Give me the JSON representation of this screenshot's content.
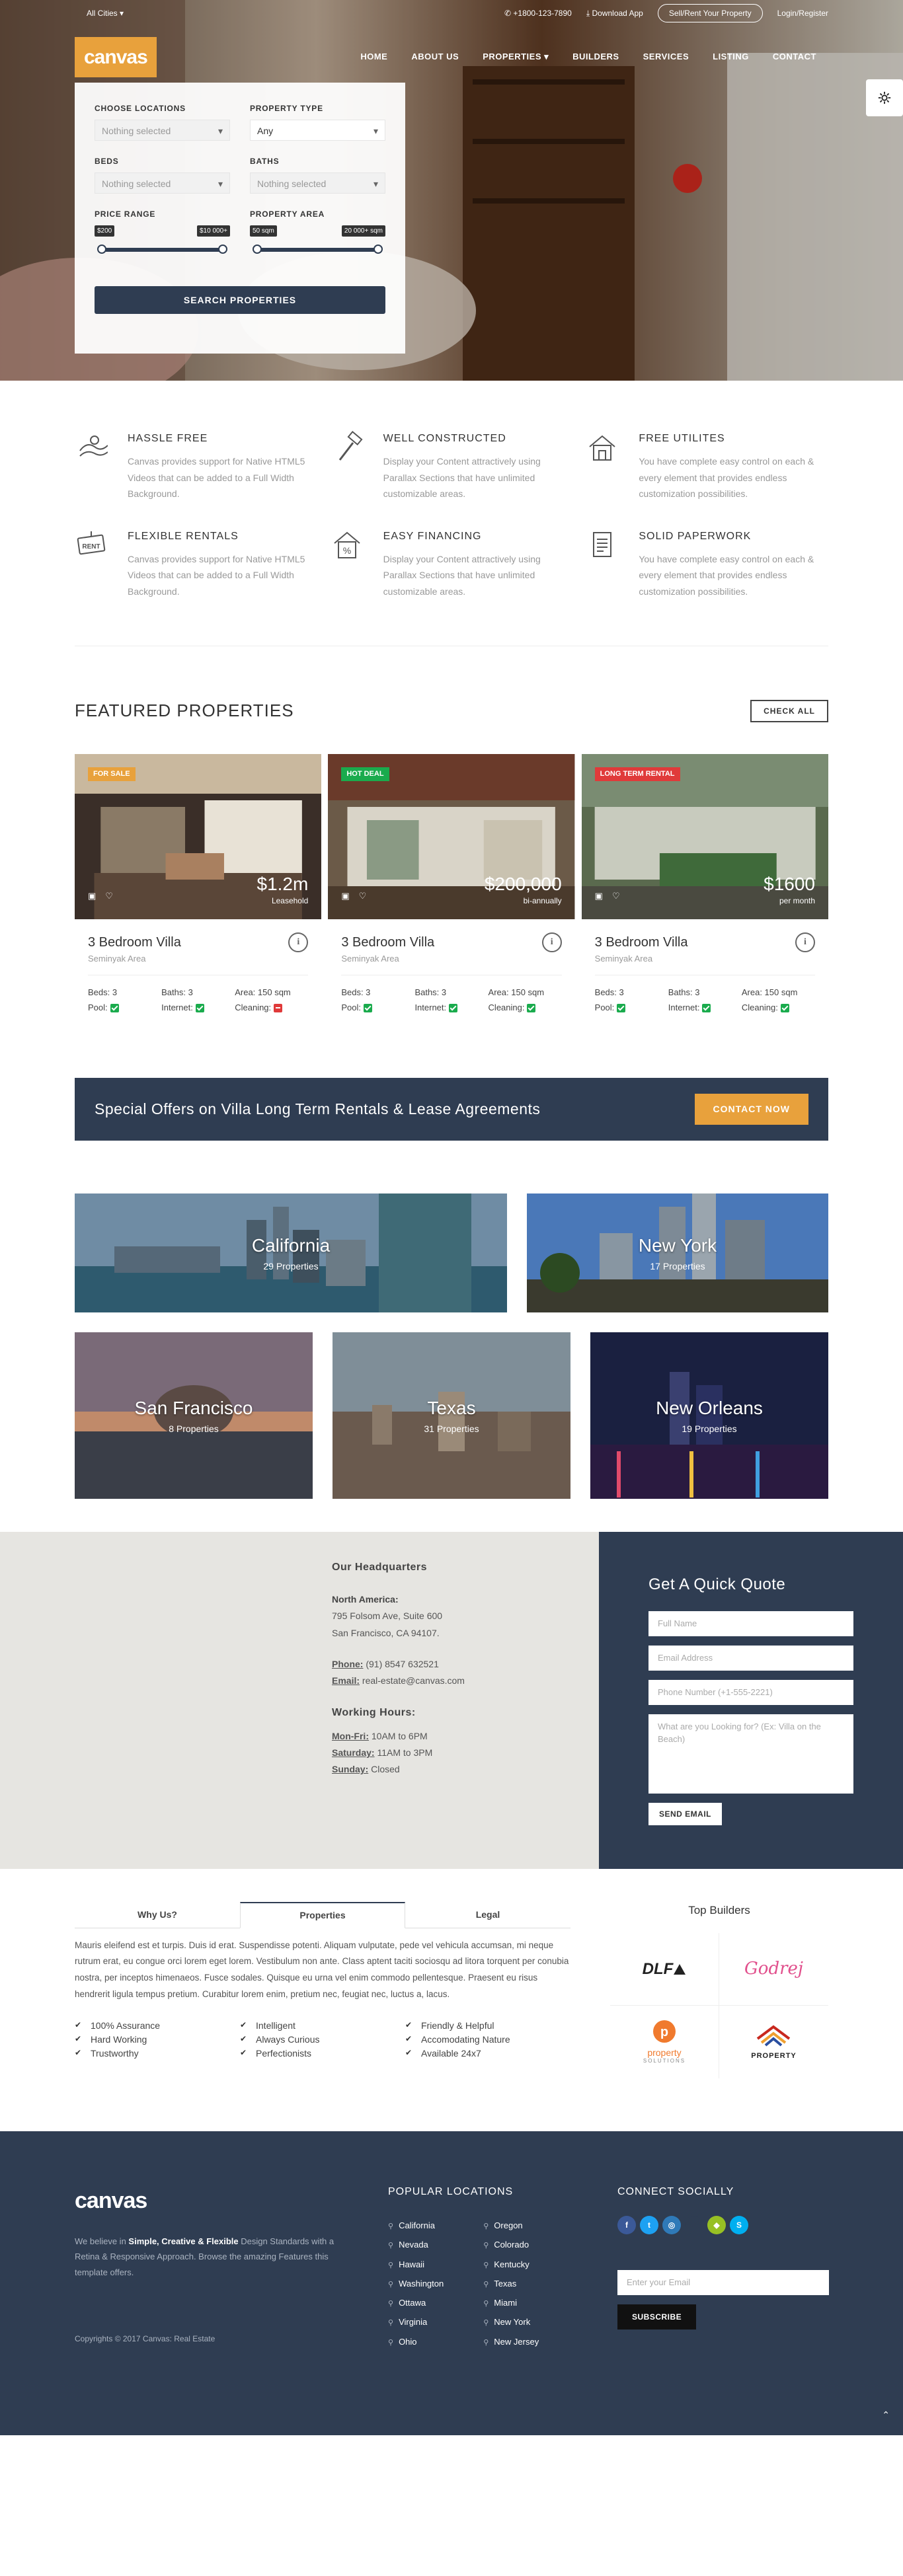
{
  "topbar": {
    "cities": "All Cities",
    "phone": "+1800-123-7890",
    "download": "Download App",
    "sell": "Sell/Rent Your Property",
    "login": "Login/Register"
  },
  "nav": {
    "logo": "canvas",
    "items": [
      "HOME",
      "ABOUT US",
      "PROPERTIES",
      "BUILDERS",
      "SERVICES",
      "LISTING",
      "CONTACT"
    ]
  },
  "search": {
    "locations_label": "CHOOSE LOCATIONS",
    "locations_value": "Nothing selected",
    "type_label": "PROPERTY TYPE",
    "type_value": "Any",
    "beds_label": "BEDS",
    "beds_value": "Nothing selected",
    "baths_label": "BATHS",
    "baths_value": "Nothing selected",
    "price_label": "PRICE RANGE",
    "price_min": "$200",
    "price_max": "$10 000+",
    "area_label": "PROPERTY AREA",
    "area_min": "50 sqm",
    "area_max": "20 000+ sqm",
    "submit": "SEARCH PROPERTIES"
  },
  "features": [
    {
      "title": "HASSLE FREE",
      "text": "Canvas provides support for Native HTML5 Videos that can be added to a Full Width Background.",
      "icon": "wave-hand-icon"
    },
    {
      "title": "WELL CONSTRUCTED",
      "text": "Display your Content attractively using Parallax Sections that have unlimited customizable areas.",
      "icon": "hammer-icon"
    },
    {
      "title": "FREE UTILITES",
      "text": "You have complete easy control on each & every element that provides endless customization possibilities.",
      "icon": "house-icon"
    },
    {
      "title": "FLEXIBLE RENTALS",
      "text": "Canvas provides support for Native HTML5 Videos that can be added to a Full Width Background.",
      "icon": "rent-sign-icon"
    },
    {
      "title": "EASY FINANCING",
      "text": "Display your Content attractively using Parallax Sections that have unlimited customizable areas.",
      "icon": "percent-house-icon"
    },
    {
      "title": "SOLID PAPERWORK",
      "text": "You have complete easy control on each & every element that provides endless customization possibilities.",
      "icon": "document-icon"
    }
  ],
  "featured": {
    "title": "FEATURED PROPERTIES",
    "check_all": "CHECK ALL",
    "properties": [
      {
        "badge": "FOR SALE",
        "badge_color": "#e8a13c",
        "price": "$1.2m",
        "period": "Leasehold",
        "title": "3 Bedroom Villa",
        "area": "Seminyak Area",
        "beds": "Beds: 3",
        "baths": "Baths: 3",
        "size": "Area: 150 sqm",
        "pool": "Pool:",
        "internet": "Internet:",
        "cleaning": "Cleaning:",
        "pool_ok": true,
        "internet_ok": true,
        "cleaning_ok": false
      },
      {
        "badge": "HOT DEAL",
        "badge_color": "#1aab4d",
        "price": "$200,000",
        "period": "bi-annually",
        "title": "3 Bedroom Villa",
        "area": "Seminyak Area",
        "beds": "Beds: 3",
        "baths": "Baths: 3",
        "size": "Area: 150 sqm",
        "pool": "Pool:",
        "internet": "Internet:",
        "cleaning": "Cleaning:",
        "pool_ok": true,
        "internet_ok": true,
        "cleaning_ok": true
      },
      {
        "badge": "LONG TERM RENTAL",
        "badge_color": "#e03a3a",
        "price": "$1600",
        "period": "per month",
        "title": "3 Bedroom Villa",
        "area": "Seminyak Area",
        "beds": "Beds: 3",
        "baths": "Baths: 3",
        "size": "Area: 150 sqm",
        "pool": "Pool:",
        "internet": "Internet:",
        "cleaning": "Cleaning:",
        "pool_ok": true,
        "internet_ok": true,
        "cleaning_ok": true
      }
    ]
  },
  "offer": {
    "title": "Special Offers on Villa Long Term Rentals & Lease Agreements",
    "button": "CONTACT NOW"
  },
  "locations": [
    {
      "name": "California",
      "count": "29 Properties"
    },
    {
      "name": "New York",
      "count": "17 Properties"
    },
    {
      "name": "San Francisco",
      "count": "8 Properties"
    },
    {
      "name": "Texas",
      "count": "31 Properties"
    },
    {
      "name": "New Orleans",
      "count": "19 Properties"
    }
  ],
  "hq": {
    "title": "Our Headquarters",
    "region": "North America:",
    "addr1": "795 Folsom Ave, Suite 600",
    "addr2": "San Francisco, CA 94107.",
    "phone_label": "Phone:",
    "phone": "(91) 8547 632521",
    "email_label": "Email:",
    "email": "real-estate@canvas.com",
    "hours_title": "Working Hours:",
    "h1_label": "Mon-Fri:",
    "h1": "10AM to 6PM",
    "h2_label": "Saturday:",
    "h2": "11AM to 3PM",
    "h3_label": "Sunday:",
    "h3": "Closed"
  },
  "quote": {
    "title": "Get A Quick Quote",
    "name_ph": "Full Name",
    "email_ph": "Email Address",
    "phone_ph": "Phone Number (+1-555-2221)",
    "message_ph": "What are you Looking for? (Ex: Villa on the Beach)",
    "send": "SEND EMAIL"
  },
  "tabs": {
    "items": [
      "Why Us?",
      "Properties",
      "Legal"
    ],
    "content": "Mauris eleifend est et turpis. Duis id erat. Suspendisse potenti. Aliquam vulputate, pede vel vehicula accumsan, mi neque rutrum erat, eu congue orci lorem eget lorem. Vestibulum non ante. Class aptent taciti sociosqu ad litora torquent per conubia nostra, per inceptos himenaeos. Fusce sodales. Quisque eu urna vel enim commodo pellentesque. Praesent eu risus hendrerit ligula tempus pretium. Curabitur lorem enim, pretium nec, feugiat nec, luctus a, lacus.",
    "perks": [
      "100% Assurance",
      "Hard Working",
      "Trustworthy",
      "Intelligent",
      "Always Curious",
      "Perfectionists",
      "Friendly & Helpful",
      "Accomodating Nature",
      "Available 24x7"
    ]
  },
  "builders": {
    "title": "Top Builders",
    "logos": [
      "DLF",
      "Godrej",
      "property",
      "PROPERTY"
    ],
    "sublabel": "SOLUTIONS"
  },
  "footer": {
    "logo": "canvas",
    "about_pre": "We believe in ",
    "about_bold": "Simple, Creative & Flexible",
    "about_post": " Design Standards with a Retina & Responsive Approach. Browse the amazing Features this template offers.",
    "copyright": "Copyrights © 2017 Canvas: Real Estate",
    "loc_title": "POPULAR LOCATIONS",
    "loc_col1": [
      "California",
      "Nevada",
      "Hawaii",
      "Washington",
      "Ottawa",
      "Virginia",
      "Ohio"
    ],
    "loc_col2": [
      "Oregon",
      "Colorado",
      "Kentucky",
      "Texas",
      "Miami",
      "New York",
      "New Jersey"
    ],
    "social_title": "CONNECT SOCIALLY",
    "socials": [
      {
        "name": "facebook-icon",
        "glyph": "f",
        "color": "#3b5998"
      },
      {
        "name": "twitter-icon",
        "glyph": "t",
        "color": "#1da1f2"
      },
      {
        "name": "dribbble-icon",
        "glyph": "◎",
        "color": "#2f7ab8"
      },
      {
        "name": "apple-icon",
        "glyph": "",
        "color": "#2f3d52"
      },
      {
        "name": "android-icon",
        "glyph": "◆",
        "color": "#97c024"
      },
      {
        "name": "skype-icon",
        "glyph": "S",
        "color": "#00aff0"
      }
    ],
    "email_ph": "Enter your Email",
    "subscribe": "SUBSCRIBE"
  }
}
